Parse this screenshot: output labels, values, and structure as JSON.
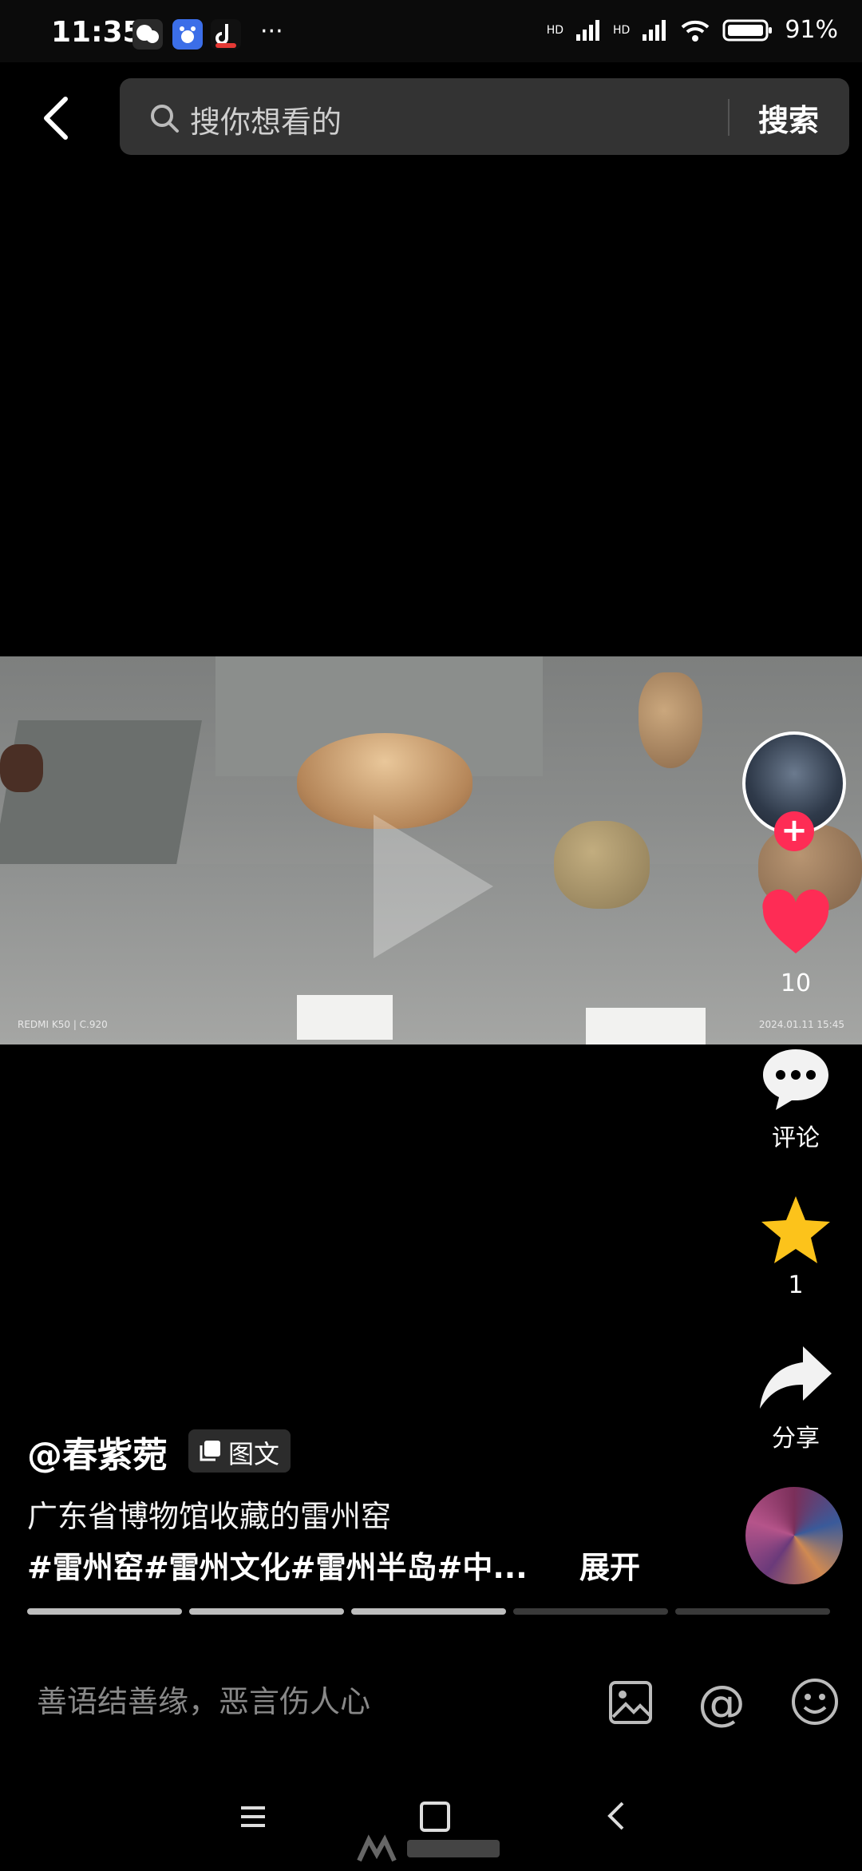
{
  "status_bar": {
    "time": "11:35",
    "network": "HD",
    "battery": "91%"
  },
  "search": {
    "placeholder": "搜你想看的",
    "button": "搜索"
  },
  "media": {
    "watermark_left": "REDMI K50 | C.920",
    "watermark_right": "2024.01.11 15:45"
  },
  "actions": {
    "like_count": "10",
    "comment_label": "评论",
    "favorite_count": "1",
    "share_label": "分享"
  },
  "post": {
    "author": "@春紫菀",
    "type_badge": "图文",
    "description": "广东省博物馆收藏的雷州窑",
    "tags": "#雷州窑#雷州文化#雷州半岛#中...",
    "expand": "展开",
    "image_progress": {
      "total": 5,
      "current": 3
    }
  },
  "comment_bar": {
    "placeholder": "善语结善缘，恶言伤人心"
  },
  "colors": {
    "accent": "#fe2c55",
    "like": "#fe2c55",
    "favorite": "#fcc31b"
  },
  "icons": [
    "back-icon",
    "search-icon",
    "heart-icon",
    "comment-icon",
    "star-icon",
    "share-icon",
    "image-icon",
    "at-icon",
    "emoji-icon",
    "menu-icon",
    "home-icon",
    "nav-back-icon"
  ]
}
